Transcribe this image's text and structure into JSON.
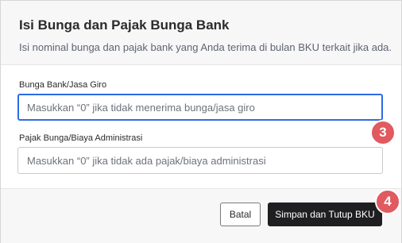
{
  "dialog": {
    "title": "Isi Bunga dan Pajak Bunga Bank",
    "subtitle": "Isi nominal bunga dan pajak bank yang Anda terima di bulan BKU terkait jika ada."
  },
  "fields": {
    "bunga": {
      "label": "Bunga Bank/Jasa Giro",
      "placeholder": "Masukkan “0” jika tidak menerima bunga/jasa giro",
      "value": ""
    },
    "pajak": {
      "label": "Pajak Bunga/Biaya Administrasi",
      "placeholder": "Masukkan “0” jika tidak ada pajak/biaya administrasi",
      "value": ""
    }
  },
  "footer": {
    "cancel_label": "Batal",
    "save_label": "Simpan dan Tutup BKU"
  },
  "annotations": {
    "step_3": "3",
    "step_4": "4"
  },
  "colors": {
    "accent_focus": "#2e6be6",
    "primary_button": "#1f1f22",
    "badge": "#e05a5f"
  }
}
